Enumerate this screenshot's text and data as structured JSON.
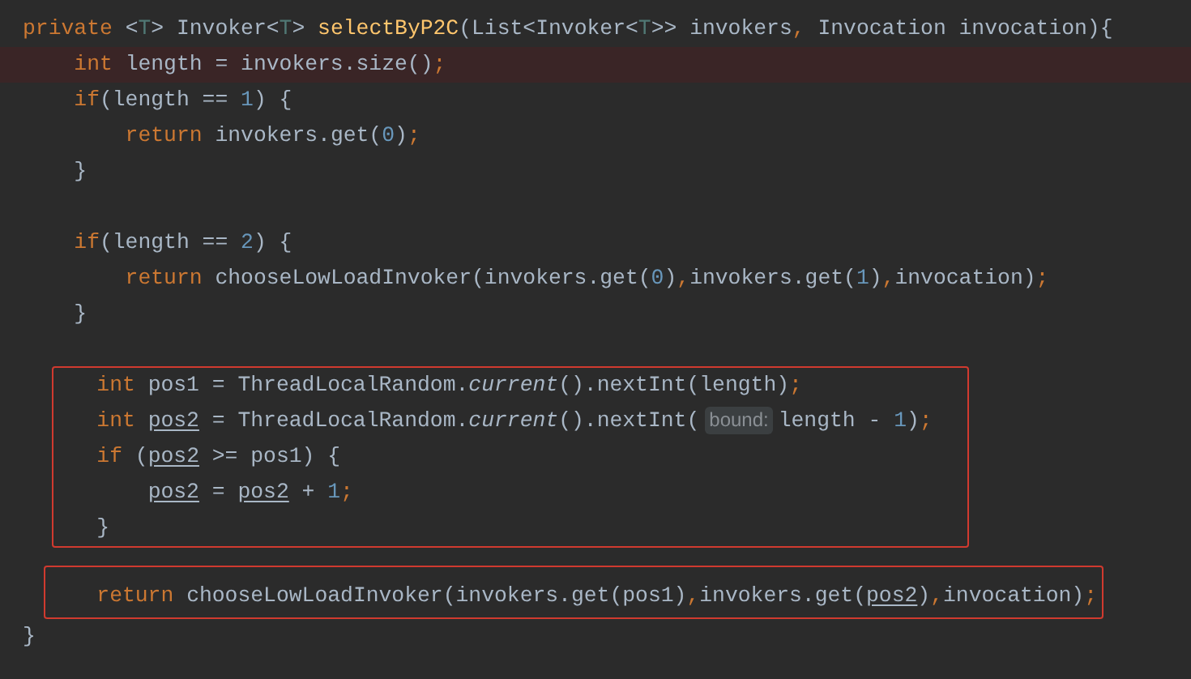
{
  "blocks": [
    {
      "boxed": false,
      "lines": [
        {
          "kind": "code",
          "highlighted": false,
          "tokens": [
            {
              "kind": "kw",
              "text": "private "
            },
            {
              "kind": "plain",
              "text": "<"
            },
            {
              "kind": "tparam",
              "text": "T"
            },
            {
              "kind": "plain",
              "text": "> Invoker<"
            },
            {
              "kind": "tparam",
              "text": "T"
            },
            {
              "kind": "plain",
              "text": "> "
            },
            {
              "kind": "decl",
              "text": "selectByP2C"
            },
            {
              "kind": "plain",
              "text": "(List<Invoker<"
            },
            {
              "kind": "tparam",
              "text": "T"
            },
            {
              "kind": "plain",
              "text": ">> invokers"
            },
            {
              "kind": "kw",
              "text": ", "
            },
            {
              "kind": "plain",
              "text": "Invocation invocation){"
            }
          ]
        },
        {
          "kind": "code",
          "highlighted": true,
          "tokens": [
            {
              "kind": "kw",
              "text": "    int "
            },
            {
              "kind": "plain",
              "text": "length = invokers.size()"
            },
            {
              "kind": "kw",
              "text": ";"
            }
          ]
        },
        {
          "kind": "code",
          "highlighted": false,
          "tokens": [
            {
              "kind": "kw",
              "text": "    if"
            },
            {
              "kind": "plain",
              "text": "(length == "
            },
            {
              "kind": "num",
              "text": "1"
            },
            {
              "kind": "plain",
              "text": ") {"
            }
          ]
        },
        {
          "kind": "code",
          "highlighted": false,
          "tokens": [
            {
              "kind": "kw",
              "text": "        return "
            },
            {
              "kind": "plain",
              "text": "invokers.get("
            },
            {
              "kind": "num",
              "text": "0"
            },
            {
              "kind": "plain",
              "text": ")"
            },
            {
              "kind": "kw",
              "text": ";"
            }
          ]
        },
        {
          "kind": "code",
          "highlighted": false,
          "tokens": [
            {
              "kind": "plain",
              "text": "    }"
            }
          ]
        },
        {
          "kind": "blank"
        },
        {
          "kind": "code",
          "highlighted": false,
          "tokens": [
            {
              "kind": "kw",
              "text": "    if"
            },
            {
              "kind": "plain",
              "text": "(length == "
            },
            {
              "kind": "num",
              "text": "2"
            },
            {
              "kind": "plain",
              "text": ") {"
            }
          ]
        },
        {
          "kind": "code",
          "highlighted": false,
          "tokens": [
            {
              "kind": "kw",
              "text": "        return "
            },
            {
              "kind": "plain",
              "text": "chooseLowLoadInvoker(invokers.get("
            },
            {
              "kind": "num",
              "text": "0"
            },
            {
              "kind": "plain",
              "text": ")"
            },
            {
              "kind": "kw",
              "text": ","
            },
            {
              "kind": "plain",
              "text": "invokers.get("
            },
            {
              "kind": "num",
              "text": "1"
            },
            {
              "kind": "plain",
              "text": ")"
            },
            {
              "kind": "kw",
              "text": ","
            },
            {
              "kind": "plain",
              "text": "invocation)"
            },
            {
              "kind": "kw",
              "text": ";"
            }
          ]
        },
        {
          "kind": "code",
          "highlighted": false,
          "tokens": [
            {
              "kind": "plain",
              "text": "    }"
            }
          ]
        },
        {
          "kind": "blank"
        }
      ]
    },
    {
      "boxed": true,
      "lines": [
        {
          "kind": "code",
          "highlighted": false,
          "tokens": [
            {
              "kind": "kw",
              "text": "    int "
            },
            {
              "kind": "plain",
              "text": "pos1 = ThreadLocalRandom."
            },
            {
              "kind": "static",
              "text": "current"
            },
            {
              "kind": "plain",
              "text": "().nextInt(length)"
            },
            {
              "kind": "kw",
              "text": ";"
            }
          ]
        },
        {
          "kind": "code",
          "highlighted": false,
          "tokens": [
            {
              "kind": "kw",
              "text": "    int "
            },
            {
              "kind": "var",
              "text": "pos2"
            },
            {
              "kind": "plain",
              "text": " = ThreadLocalRandom."
            },
            {
              "kind": "static",
              "text": "current"
            },
            {
              "kind": "plain",
              "text": "().nextInt("
            },
            {
              "kind": "hint",
              "text": "bound:"
            },
            {
              "kind": "plain",
              "text": "length - "
            },
            {
              "kind": "num",
              "text": "1"
            },
            {
              "kind": "plain",
              "text": ")"
            },
            {
              "kind": "kw",
              "text": ";"
            }
          ]
        },
        {
          "kind": "code",
          "highlighted": false,
          "tokens": [
            {
              "kind": "kw",
              "text": "    if "
            },
            {
              "kind": "plain",
              "text": "("
            },
            {
              "kind": "var",
              "text": "pos2"
            },
            {
              "kind": "plain",
              "text": " >= pos1) {"
            }
          ]
        },
        {
          "kind": "code",
          "highlighted": false,
          "tokens": [
            {
              "kind": "var",
              "text": "        pos2"
            },
            {
              "kind": "plain",
              "text": " = "
            },
            {
              "kind": "var",
              "text": "pos2"
            },
            {
              "kind": "plain",
              "text": " + "
            },
            {
              "kind": "num",
              "text": "1"
            },
            {
              "kind": "kw",
              "text": ";"
            }
          ]
        },
        {
          "kind": "code",
          "highlighted": false,
          "tokens": [
            {
              "kind": "plain",
              "text": "    }"
            }
          ]
        }
      ]
    },
    {
      "boxed": false,
      "lines": [
        {
          "kind": "blank"
        }
      ]
    },
    {
      "boxed": true,
      "lines": [
        {
          "kind": "code",
          "highlighted": false,
          "tokens": [
            {
              "kind": "kw",
              "text": "    return "
            },
            {
              "kind": "plain",
              "text": "chooseLowLoadInvoker(invokers.get(pos1)"
            },
            {
              "kind": "kw",
              "text": ","
            },
            {
              "kind": "plain",
              "text": "invokers.get("
            },
            {
              "kind": "var",
              "text": "pos2"
            },
            {
              "kind": "plain",
              "text": ")"
            },
            {
              "kind": "kw",
              "text": ","
            },
            {
              "kind": "plain",
              "text": "invocation)"
            },
            {
              "kind": "kw",
              "text": ";"
            }
          ]
        }
      ]
    },
    {
      "boxed": false,
      "lines": [
        {
          "kind": "code",
          "highlighted": false,
          "tokens": [
            {
              "kind": "plain",
              "text": "}"
            }
          ]
        }
      ]
    }
  ]
}
